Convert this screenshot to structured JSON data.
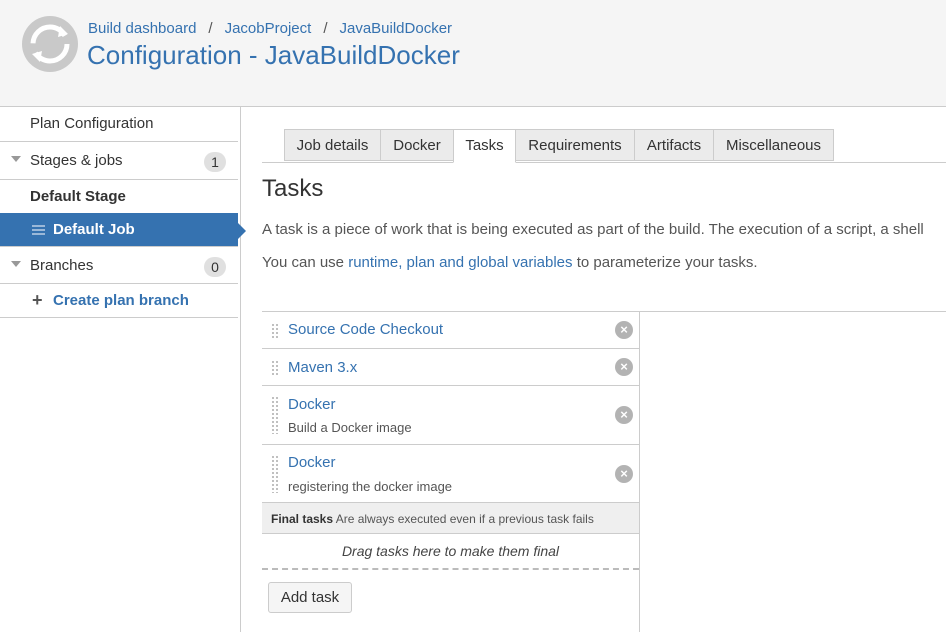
{
  "header": {
    "breadcrumbs": [
      "Build dashboard",
      "JacobProject",
      "JavaBuildDocker"
    ],
    "separator": "/",
    "title": "Configuration - JavaBuildDocker"
  },
  "sidebar": {
    "plan_configuration": "Plan Configuration",
    "stages_jobs": {
      "label": "Stages & jobs",
      "count": "1"
    },
    "default_stage": "Default Stage",
    "default_job": "Default Job",
    "branches": {
      "label": "Branches",
      "count": "0"
    },
    "create_plan_branch": "Create plan branch"
  },
  "tabs": [
    "Job details",
    "Docker",
    "Tasks",
    "Requirements",
    "Artifacts",
    "Miscellaneous"
  ],
  "selected_tab": "Tasks",
  "main": {
    "heading": "Tasks",
    "description": "A task is a piece of work that is being executed as part of the build. The execution of a script, a shell",
    "variables_prefix": "You can use",
    "variables_link": "runtime, plan and global variables",
    "variables_suffix": "to parameterize your tasks."
  },
  "tasks": [
    {
      "name": "Source Code Checkout",
      "sub": ""
    },
    {
      "name": "Maven 3.x",
      "sub": ""
    },
    {
      "name": "Docker",
      "sub": "Build a Docker image"
    },
    {
      "name": "Docker",
      "sub": "registering the docker image"
    }
  ],
  "final_tasks": {
    "label": "Final tasks",
    "note": "Are always executed even if a previous task fails",
    "dropzone": "Drag tasks here to make them final"
  },
  "add_task": "Add task",
  "colors": {
    "link": "#3572b0",
    "active": "#3572b0",
    "header_bg": "#f5f5f5"
  }
}
